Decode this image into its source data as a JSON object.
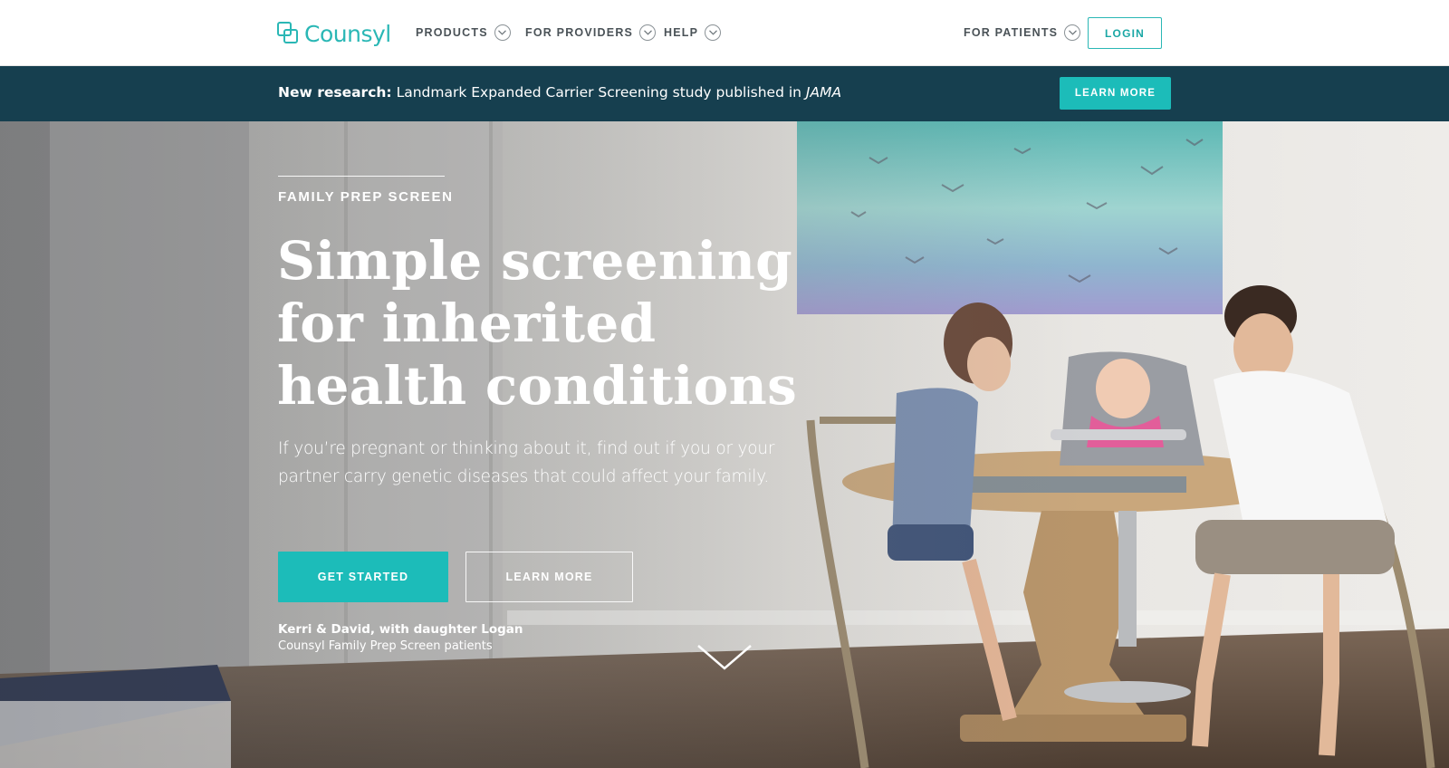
{
  "brand": {
    "name": "Counsyl",
    "color": "#2ab7b5"
  },
  "nav": {
    "items": [
      {
        "label": "PRODUCTS",
        "icon": "chevron-down-icon"
      },
      {
        "label": "FOR PROVIDERS",
        "icon": "chevron-down-icon"
      },
      {
        "label": "HELP",
        "icon": "chevron-down-icon"
      }
    ],
    "for_patients": {
      "label": "FOR PATIENTS",
      "icon": "chevron-down-icon"
    },
    "login_label": "LOGIN"
  },
  "banner": {
    "lead": "New research:",
    "text": "Landmark Expanded Carrier Screening study published in",
    "journal": "JAMA",
    "button_label": "LEARN MORE",
    "background": "#163f4f"
  },
  "hero": {
    "eyebrow": "FAMILY PREP SCREEN",
    "headline_lines": [
      "Simple screening",
      "for inherited",
      "health conditions"
    ],
    "subtext_lines": [
      "If you’re pregnant or thinking about it, find out if you or your",
      "partner carry genetic diseases that could affect your family."
    ],
    "primary_button": "GET STARTED",
    "secondary_button": "LEARN MORE",
    "caption_name": "Kerri & David, with daughter Logan",
    "caption_sub": "Counsyl Family Prep Screen patients",
    "scroll_icon": "chevron-down-icon",
    "accent": "#1cbcb9"
  }
}
